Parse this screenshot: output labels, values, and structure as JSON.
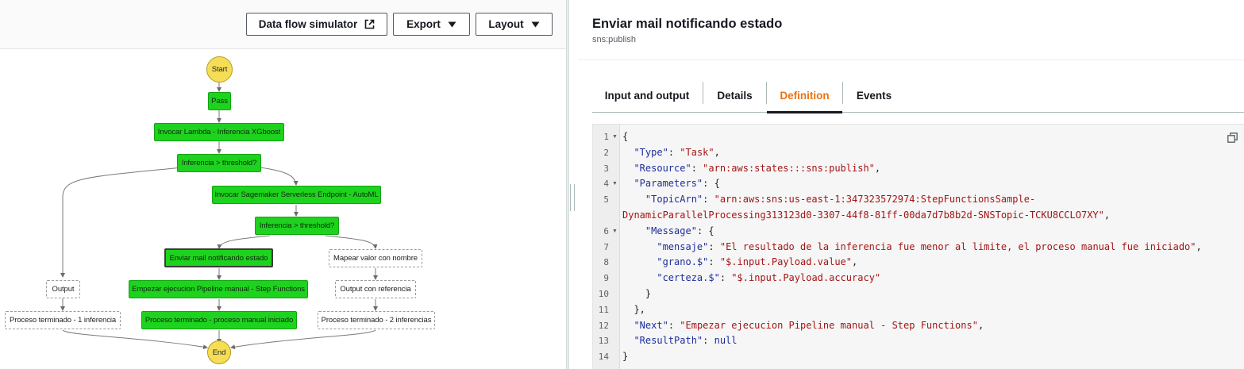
{
  "toolbar": {
    "data_flow_simulator": "Data flow simulator",
    "export": "Export",
    "layout": "Layout",
    "icons": {
      "external": "external-link-icon",
      "dropdown": "caret-down-icon"
    }
  },
  "graph": {
    "nodes": {
      "start": "Start",
      "pass": "Pass",
      "lambda": "Invocar Lambda - Inferencia XGboost",
      "choice1": "Inferencia > threshold?",
      "sagemaker": "Invocar Sagemaker Serverless Endpoint - AutoML",
      "choice2": "Inferencia > threshold?",
      "mail": "Enviar mail notificando estado",
      "map": "Mapear valor con nombre",
      "output": "Output",
      "pipeline": "Empezar ejecucion Pipeline manual - Step Functions",
      "output_ref": "Output con referencia",
      "proc1": "Proceso terminado - 1 inferencia",
      "proc_manual": "Proceso terminado - proceso manual iniciado",
      "proc2": "Proceso terminado - 2 inferencias",
      "end": "End"
    },
    "colors": {
      "task_green": "#1ed31e",
      "terminal_yellow": "#f5de56"
    }
  },
  "details": {
    "title": "Enviar mail notificando estado",
    "subtitle": "sns:publish",
    "tabs": [
      "Input and output",
      "Details",
      "Definition",
      "Events"
    ],
    "active_tab": "Definition",
    "accent_color": "#ec7211"
  },
  "code": {
    "lines": [
      {
        "n": "1",
        "fold": true,
        "parts": [
          [
            "p",
            "{"
          ]
        ]
      },
      {
        "n": "2",
        "fold": false,
        "parts": [
          [
            "p",
            "  "
          ],
          [
            "k",
            "\"Type\""
          ],
          [
            "p",
            ": "
          ],
          [
            "s",
            "\"Task\""
          ],
          [
            "p",
            ","
          ]
        ]
      },
      {
        "n": "3",
        "fold": false,
        "parts": [
          [
            "p",
            "  "
          ],
          [
            "k",
            "\"Resource\""
          ],
          [
            "p",
            ": "
          ],
          [
            "s",
            "\"arn:aws:states:::sns:publish\""
          ],
          [
            "p",
            ","
          ]
        ]
      },
      {
        "n": "4",
        "fold": true,
        "parts": [
          [
            "p",
            "  "
          ],
          [
            "k",
            "\"Parameters\""
          ],
          [
            "p",
            ": {"
          ]
        ]
      },
      {
        "n": "5",
        "fold": false,
        "parts": [
          [
            "p",
            "    "
          ],
          [
            "k",
            "\"TopicArn\""
          ],
          [
            "p",
            ": "
          ],
          [
            "s",
            "\"arn:aws:sns:us-east-1:347323572974:StepFunctionsSample-"
          ]
        ]
      },
      {
        "n": "",
        "fold": false,
        "parts": [
          [
            "s",
            "DynamicParallelProcessing313123d0-3307-44f8-81ff-00da7d7b8b2d-SNSTopic-TCKU8CCLO7XY\""
          ],
          [
            "p",
            ","
          ]
        ]
      },
      {
        "n": "6",
        "fold": true,
        "parts": [
          [
            "p",
            "    "
          ],
          [
            "k",
            "\"Message\""
          ],
          [
            "p",
            ": {"
          ]
        ]
      },
      {
        "n": "7",
        "fold": false,
        "parts": [
          [
            "p",
            "      "
          ],
          [
            "k",
            "\"mensaje\""
          ],
          [
            "p",
            ": "
          ],
          [
            "s",
            "\"El resultado de la inferencia fue menor al limite, el proceso manual fue iniciado\""
          ],
          [
            "p",
            ","
          ]
        ]
      },
      {
        "n": "8",
        "fold": false,
        "parts": [
          [
            "p",
            "      "
          ],
          [
            "k",
            "\"grano.$\""
          ],
          [
            "p",
            ": "
          ],
          [
            "s",
            "\"$.input.Payload.value\""
          ],
          [
            "p",
            ","
          ]
        ]
      },
      {
        "n": "9",
        "fold": false,
        "parts": [
          [
            "p",
            "      "
          ],
          [
            "k",
            "\"certeza.$\""
          ],
          [
            "p",
            ": "
          ],
          [
            "s",
            "\"$.input.Payload.accuracy\""
          ]
        ]
      },
      {
        "n": "10",
        "fold": false,
        "parts": [
          [
            "p",
            "    }"
          ]
        ]
      },
      {
        "n": "11",
        "fold": false,
        "parts": [
          [
            "p",
            "  },"
          ]
        ]
      },
      {
        "n": "12",
        "fold": false,
        "parts": [
          [
            "p",
            "  "
          ],
          [
            "k",
            "\"Next\""
          ],
          [
            "p",
            ": "
          ],
          [
            "s",
            "\"Empezar ejecucion Pipeline manual - Step Functions\""
          ],
          [
            "p",
            ","
          ]
        ]
      },
      {
        "n": "13",
        "fold": false,
        "parts": [
          [
            "p",
            "  "
          ],
          [
            "k",
            "\"ResultPath\""
          ],
          [
            "p",
            ": "
          ],
          [
            "n",
            "null"
          ]
        ]
      },
      {
        "n": "14",
        "fold": false,
        "parts": [
          [
            "p",
            "}"
          ]
        ]
      }
    ]
  }
}
